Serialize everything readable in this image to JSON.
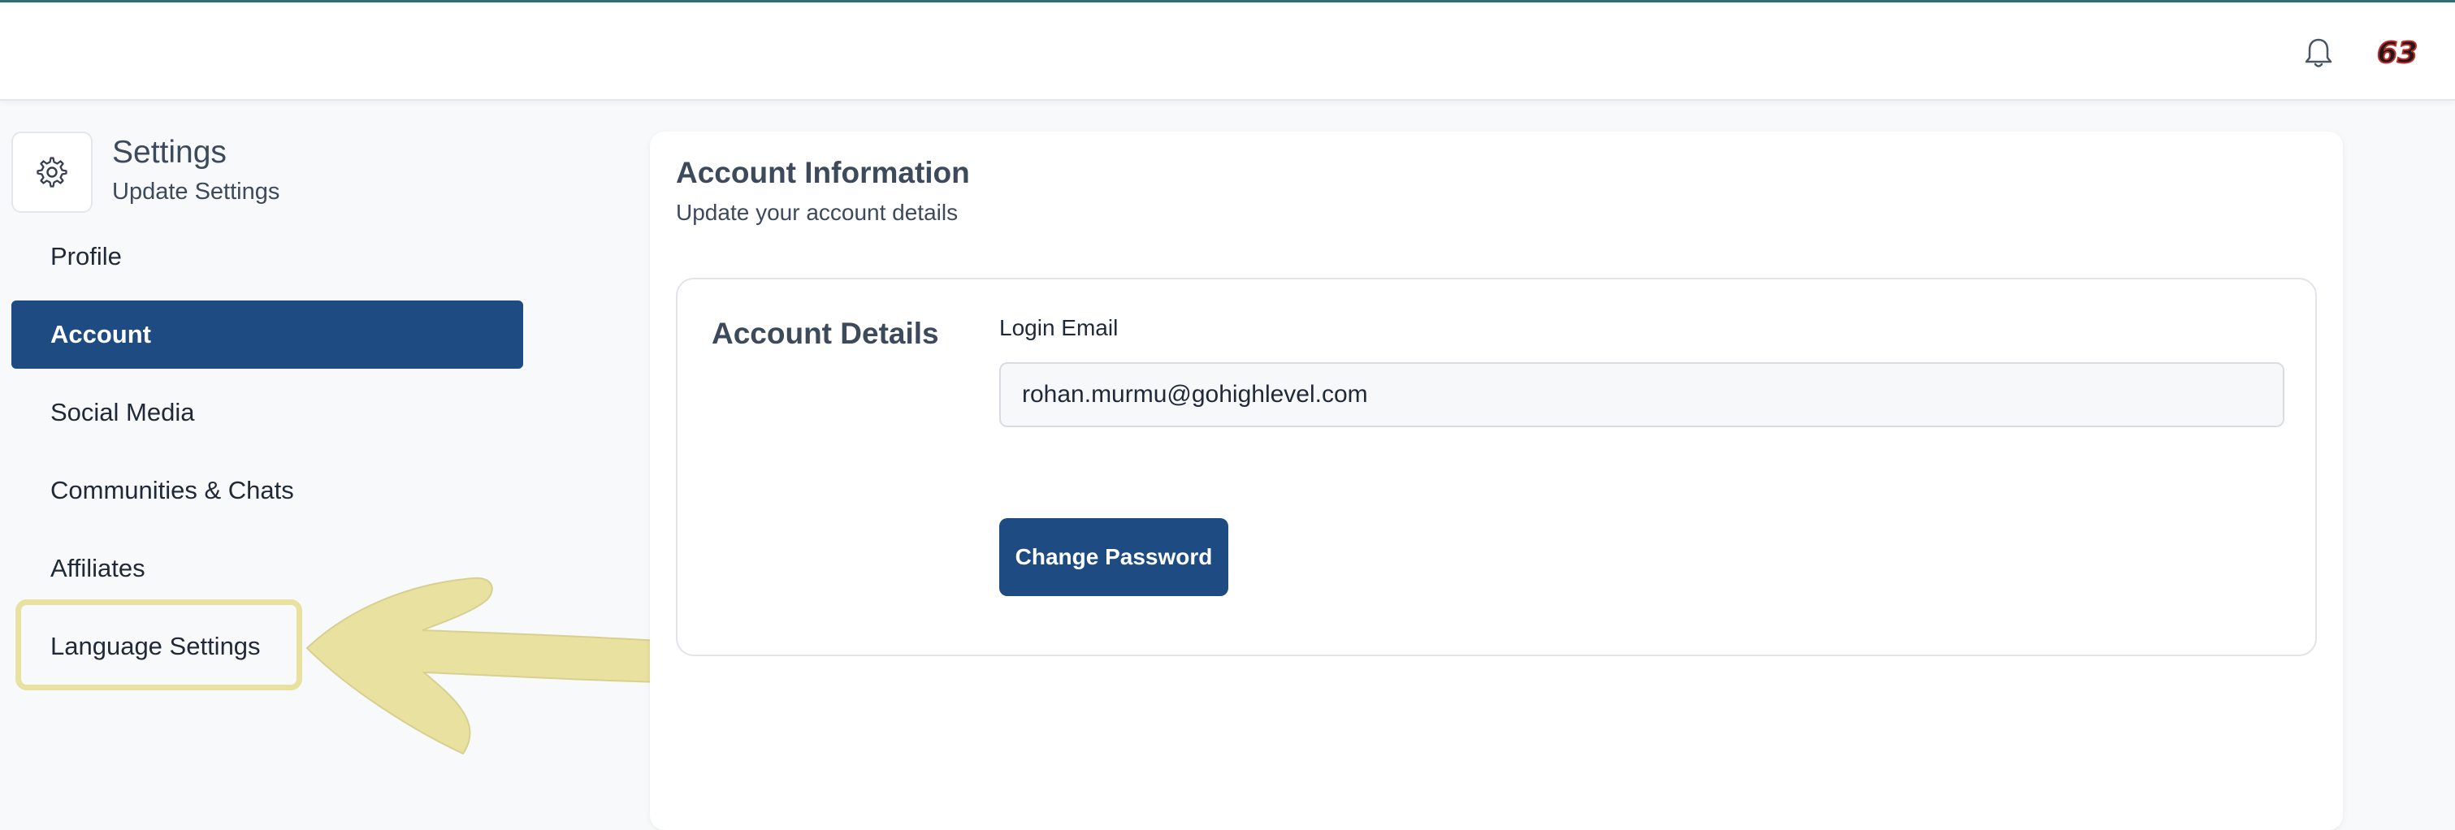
{
  "header": {
    "notification_icon": "bell-icon",
    "avatar_text": "63"
  },
  "sidebar": {
    "header_icon": "gear-icon",
    "title": "Settings",
    "subtitle": "Update Settings",
    "items": [
      {
        "label": "Profile",
        "active": false
      },
      {
        "label": "Account",
        "active": true
      },
      {
        "label": "Social Media",
        "active": false
      },
      {
        "label": "Communities & Chats",
        "active": false
      },
      {
        "label": "Affiliates",
        "active": false
      },
      {
        "label": "Language Settings",
        "active": false,
        "highlighted": true
      }
    ]
  },
  "main": {
    "title": "Account Information",
    "subtitle": "Update your account details",
    "section": {
      "title": "Account Details",
      "email_label": "Login Email",
      "email_value": "rohan.murmu@gohighlevel.com",
      "change_password_label": "Change Password"
    }
  },
  "colors": {
    "primary": "#1d4b82",
    "highlight": "#e8e1a0",
    "top_border": "#2f6f73"
  }
}
